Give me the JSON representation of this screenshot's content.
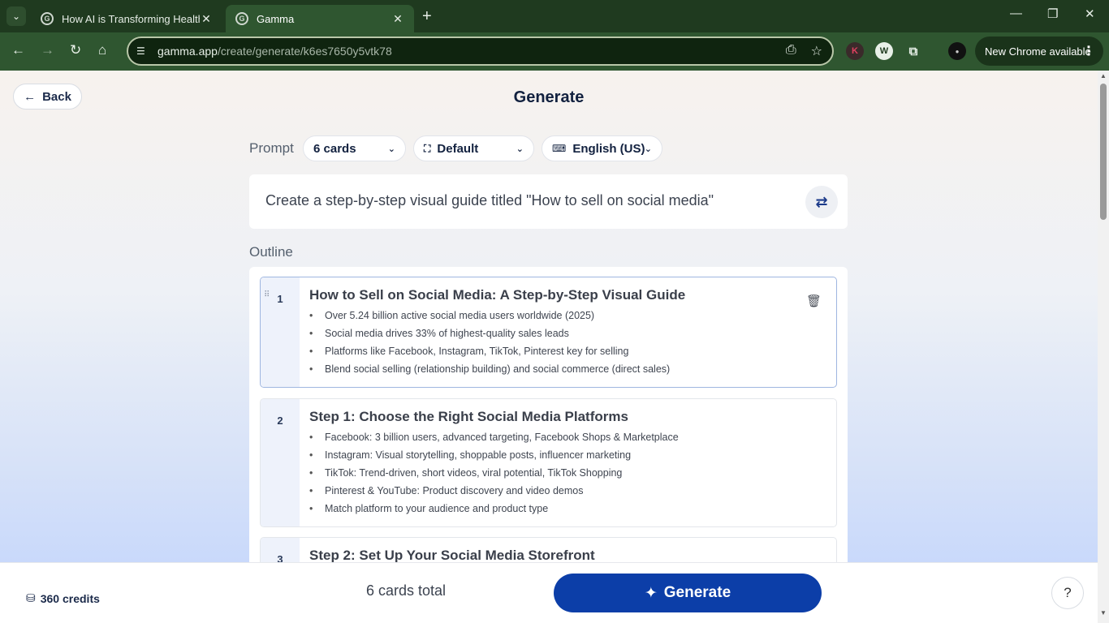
{
  "browser": {
    "tabs": [
      {
        "title": "How AI is Transforming Health",
        "favicon": "G"
      },
      {
        "title": "Gamma",
        "favicon": "G"
      }
    ],
    "url_host": "gamma.app",
    "url_path": "/create/generate/k6es7650y5vtk78",
    "update_chip": "New Chrome available"
  },
  "header": {
    "back_label": "Back",
    "title": "Generate"
  },
  "settings": {
    "prompt_label": "Prompt",
    "cards_select": "6 cards",
    "theme_select": "Default",
    "language_select": "English (US)"
  },
  "prompt": {
    "text": "Create a step-by-step visual guide titled \"How to sell on social media\""
  },
  "outline": {
    "label": "Outline",
    "cards": [
      {
        "number": "1",
        "title": "How to Sell on Social Media: A Step-by-Step Visual Guide",
        "bullets": [
          "Over 5.24 billion active social media users worldwide (2025)",
          "Social media drives 33% of highest-quality sales leads",
          "Platforms like Facebook, Instagram, TikTok, Pinterest key for selling",
          "Blend social selling (relationship building) and social commerce (direct sales)"
        ]
      },
      {
        "number": "2",
        "title": "Step 1: Choose the Right Social Media Platforms",
        "bullets": [
          "Facebook: 3 billion users, advanced targeting, Facebook Shops & Marketplace",
          "Instagram: Visual storytelling, shoppable posts, influencer marketing",
          "TikTok: Trend-driven, short videos, viral potential, TikTok Shopping",
          "Pinterest & YouTube: Product discovery and video demos",
          "Match platform to your audience and product type"
        ]
      },
      {
        "number": "3",
        "title": "Step 2: Set Up Your Social Media Storefront",
        "bullets": []
      }
    ]
  },
  "footer": {
    "credits": "360 credits",
    "total": "6 cards total",
    "generate_label": "Generate",
    "help": "?"
  },
  "colors": {
    "primary": "#0c3ea8",
    "browser_frame": "#2f5630"
  }
}
